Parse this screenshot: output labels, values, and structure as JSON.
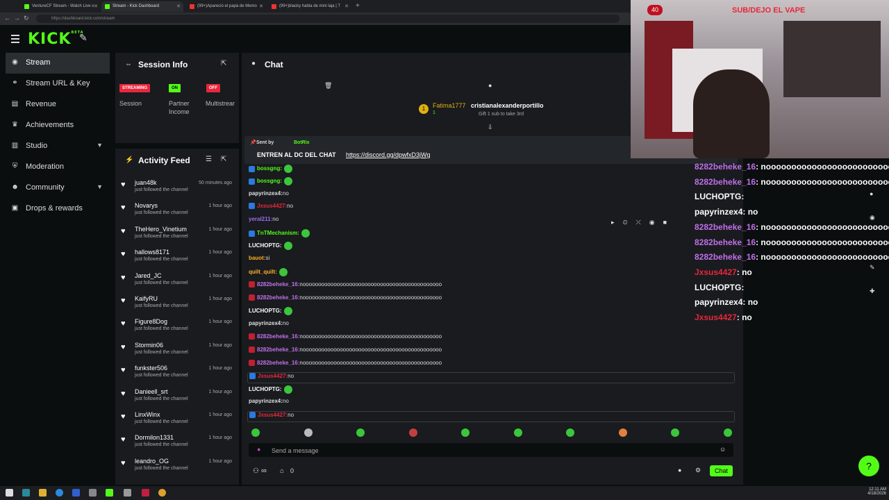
{
  "browser": {
    "tabs": [
      "VentureCF Stream - Watch Live o",
      "Stream - Kick Dashboard",
      "(99+)Apareció el papá de Memo",
      "(99+)blacky habla de mini laja | T"
    ],
    "url": "https://dashboard.kick.com/stream"
  },
  "brand": {
    "logo": "KICK",
    "logo_sup": "BETA"
  },
  "sidebar": {
    "items": [
      {
        "label": "Stream",
        "icon": "broadcast-icon"
      },
      {
        "label": "Stream URL & Key",
        "icon": "link-icon"
      },
      {
        "label": "Revenue",
        "icon": "bank-icon"
      },
      {
        "label": "Achievements",
        "icon": "trophy-icon"
      },
      {
        "label": "Studio",
        "icon": "book-icon"
      },
      {
        "label": "Moderation",
        "icon": "shield-icon"
      },
      {
        "label": "Community",
        "icon": "users-icon"
      },
      {
        "label": "Drops & rewards",
        "icon": "gift-icon"
      }
    ]
  },
  "session": {
    "title": "Session Info",
    "cards": [
      {
        "badge": "STREAMING",
        "label": "Session",
        "color": "#e8273b"
      },
      {
        "badge": "ON",
        "label": "Partner Income",
        "color": "#53fc18"
      },
      {
        "badge": "OFF",
        "label": "Multistrear",
        "color": "#e8273b"
      }
    ]
  },
  "activity": {
    "title": "Activity Feed",
    "items": [
      {
        "name": "juan48k",
        "desc": "just followed the channel",
        "time": "50 minutes ago"
      },
      {
        "name": "Novarys",
        "desc": "just followed the channel",
        "time": "1 hour ago"
      },
      {
        "name": "TheHero_Vinetium",
        "desc": "just followed the channel",
        "time": "1 hour ago"
      },
      {
        "name": "hallows8171",
        "desc": "just followed the channel",
        "time": "1 hour ago"
      },
      {
        "name": "Jared_JC",
        "desc": "just followed the channel",
        "time": "1 hour ago"
      },
      {
        "name": "KaifyRU",
        "desc": "just followed the channel",
        "time": "1 hour ago"
      },
      {
        "name": "Figure8Dog",
        "desc": "just followed the channel",
        "time": "1 hour ago"
      },
      {
        "name": "Stormin06",
        "desc": "just followed the channel",
        "time": "1 hour ago"
      },
      {
        "name": "funkster506",
        "desc": "just followed the channel",
        "time": "1 hour ago"
      },
      {
        "name": "Danieell_srt",
        "desc": "just followed the channel",
        "time": "1 hour ago"
      },
      {
        "name": "LinxWinx",
        "desc": "just followed the channel",
        "time": "1 hour ago"
      },
      {
        "name": "Dormilon1331",
        "desc": "just followed the channel",
        "time": "1 hour ago"
      },
      {
        "name": "leandro_OG",
        "desc": "just followed the channel",
        "time": "1 hour ago"
      }
    ]
  },
  "chat": {
    "title": "Chat",
    "gift": {
      "gifter": "Fatima1777",
      "gifter_count": "1",
      "recipient": "cristianalexanderportillo",
      "caption": "Gift 1 sub to take 3rd"
    },
    "pinned": {
      "sent_by": "Sent by",
      "bot": "BotRix",
      "text": "ENTREN AL DC DEL CHAT",
      "link": "https://discord.gg/dpwfxD3jWg"
    },
    "messages": [
      {
        "user": "bossgng:",
        "text": "",
        "color": "#53fc18",
        "emote": true
      },
      {
        "user": "bossgng:",
        "text": "",
        "color": "#53fc18",
        "emote": true
      },
      {
        "user": "papyrinzex4:",
        "text": "no",
        "color": "#e0e0e0"
      },
      {
        "user": "Jxsus4427:",
        "text": "no",
        "color": "#e8273b"
      },
      {
        "user": "yeral211:",
        "text": "no",
        "color": "#9b6cf0"
      },
      {
        "user": "TnTMechanism:",
        "text": "",
        "color": "#53fc18",
        "emote": true
      },
      {
        "user": "LUCHOPTG:",
        "text": "",
        "color": "#ffffff",
        "emote": true
      },
      {
        "user": "bauot:",
        "text": "si",
        "color": "#ffb020"
      },
      {
        "user": "quilt_quilt:",
        "text": "",
        "color": "#ffb020",
        "emote": true
      },
      {
        "user": "8282beheke_16:",
        "text": "nooooooooooooooooooooooooooooooooooooooooooooo",
        "color": "#c070e8"
      },
      {
        "user": "8282beheke_16:",
        "text": "nooooooooooooooooooooooooooooooooooooooooooooo",
        "color": "#c070e8"
      },
      {
        "user": "LUCHOPTG:",
        "text": "",
        "color": "#ffffff",
        "emote": true
      },
      {
        "user": "papyrinzex4:",
        "text": "no",
        "color": "#e0e0e0"
      },
      {
        "user": "8282beheke_16:",
        "text": "nooooooooooooooooooooooooooooooooooooooooooooo",
        "color": "#c070e8"
      },
      {
        "user": "8282beheke_16:",
        "text": "nooooooooooooooooooooooooooooooooooooooooooooo",
        "color": "#c070e8"
      },
      {
        "user": "8282beheke_16:",
        "text": "nooooooooooooooooooooooooooooooooooooooooooooo",
        "color": "#c070e8"
      },
      {
        "user": "Jxsus4427:",
        "text": "no",
        "color": "#e8273b"
      },
      {
        "user": "LUCHOPTG:",
        "text": "",
        "color": "#ffffff",
        "emote": true
      },
      {
        "user": "papyrinzex4:",
        "text": "no",
        "color": "#e0e0e0"
      },
      {
        "user": "Jxsus4427:",
        "text": "no",
        "color": "#e8273b"
      }
    ],
    "input_placeholder": "Send a message",
    "viewers_left": "∞",
    "viewers_right": "0",
    "send_label": "Chat"
  },
  "webcam": {
    "counter": "40",
    "banner": "SUB/DEJO EL VAPE"
  },
  "overlay_chat": [
    {
      "user": "8282beheke_16",
      "text": ": nooooooooooooooooooooooooooooooo",
      "color": "#c070e8"
    },
    {
      "user": "8282beheke_16",
      "text": ": nooooooooooooooooooooooooooooooo",
      "color": "#c070e8"
    },
    {
      "user": "LUCHOPTG",
      "text": ":",
      "color": "#ffffff"
    },
    {
      "user": "papyrinzex4",
      "text": ": no",
      "color": "#ffffff"
    },
    {
      "user": "8282beheke_16",
      "text": ": nooooooooooooooooooooooooooooooo",
      "color": "#c070e8"
    },
    {
      "user": "8282beheke_16",
      "text": ": nooooooooooooooooooooooooooooooo",
      "color": "#c070e8"
    },
    {
      "user": "8282beheke_16",
      "text": ": nooooooooooooooooooooooooooooooo",
      "color": "#c070e8"
    },
    {
      "user": "Jxsus4427",
      "text": ": no",
      "color": "#e8273b"
    },
    {
      "user": "LUCHOPTG",
      "text": ":",
      "color": "#ffffff"
    },
    {
      "user": "papyrinzex4",
      "text": ": no",
      "color": "#ffffff"
    },
    {
      "user": "Jxsus4427",
      "text": ": no",
      "color": "#e8273b"
    }
  ],
  "taskbar": {
    "time": "12:11 AM",
    "date": "4/18/2026"
  },
  "colors": {
    "accent": "#53fc18",
    "panel": "#191b1f",
    "bg": "#0b0e0f",
    "live": "#e8273b"
  }
}
